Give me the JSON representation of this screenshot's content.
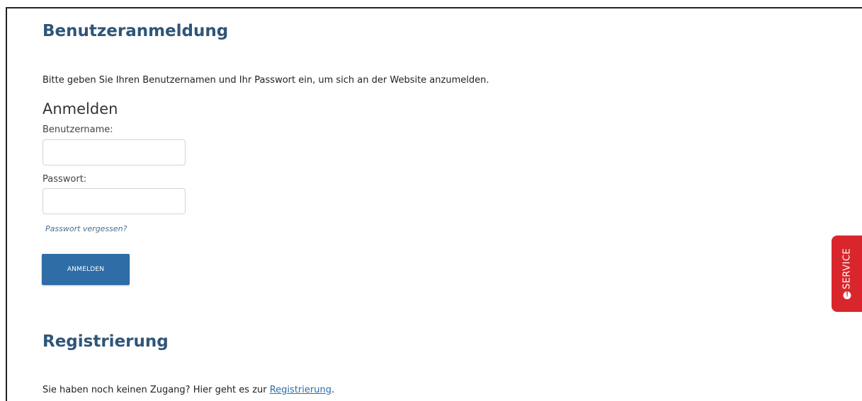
{
  "login": {
    "title": "Benutzeranmeldung",
    "intro": "Bitte geben Sie Ihren Benutzernamen und Ihr Passwort ein, um sich an der Website anzumelden.",
    "form_heading": "Anmelden",
    "username_label": "Benutzername:",
    "username_value": "",
    "password_label": "Passwort:",
    "password_value": "",
    "forgot_link": "Passwort vergessen?",
    "submit_label": "ANMELDEN"
  },
  "registration": {
    "title": "Registrierung",
    "text_before": "Sie haben noch keinen Zugang? Hier geht es zur ",
    "link_label": "Registrierung",
    "text_after": "."
  },
  "service_tab": {
    "label": "SERVICE",
    "icon": "info-icon",
    "icon_glyph": "!",
    "color": "#d9262c"
  },
  "colors": {
    "heading": "#2f5578",
    "button": "#2f6da6",
    "link": "#2f6da6"
  }
}
